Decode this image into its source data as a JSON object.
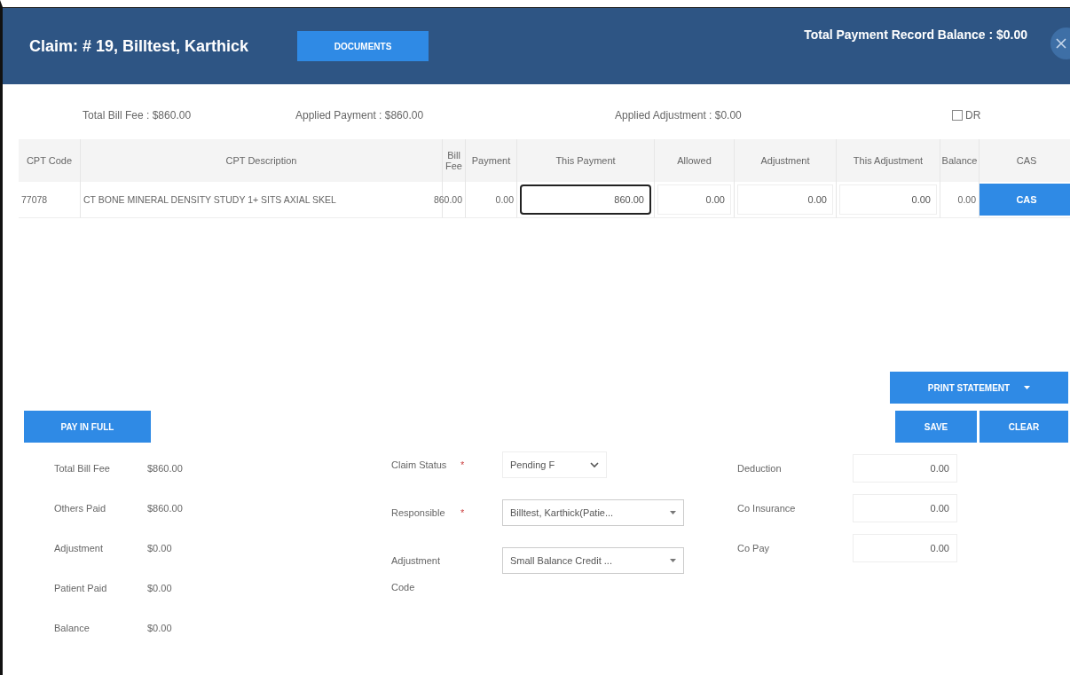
{
  "header": {
    "title": "Claim: # 19, Billtest, Karthick",
    "documents_button": "DOCUMENTS",
    "balance": "Total Payment Record Balance : $0.00"
  },
  "summary": {
    "total_bill_fee": "Total Bill Fee : $860.00",
    "applied_payment": "Applied Payment : $860.00",
    "applied_adjustment": "Applied Adjustment : $0.00",
    "dr": {
      "label": "DR",
      "checked": false
    }
  },
  "table": {
    "columns": [
      "CPT Code",
      "CPT Description",
      "Bill Fee",
      "Payment",
      "This Payment",
      "Allowed",
      "Adjustment",
      "This Adjustment",
      "Balance",
      "CAS"
    ],
    "rows": [
      {
        "cells": [
          {
            "kind": "text",
            "value": "77078"
          },
          {
            "kind": "text",
            "value": "CT BONE MINERAL DENSITY STUDY 1+ SITS AXIAL SKEL"
          },
          {
            "kind": "number",
            "value": "860.00"
          },
          {
            "kind": "number",
            "value": "0.00"
          },
          {
            "kind": "input",
            "value": "860.00",
            "focused": true
          },
          {
            "kind": "input",
            "value": "0.00",
            "focused": false
          },
          {
            "kind": "input",
            "value": "0.00",
            "focused": false
          },
          {
            "kind": "input",
            "value": "0.00",
            "focused": false
          },
          {
            "kind": "number",
            "value": "0.00"
          },
          {
            "kind": "button",
            "value": "CAS"
          }
        ]
      }
    ]
  },
  "actions": {
    "pay_in_full": "PAY IN FULL",
    "print_statement": "PRINT STATEMENT",
    "save": "SAVE",
    "clear": "CLEAR"
  },
  "totals": [
    {
      "label": "Total Bill Fee",
      "value": "$860.00"
    },
    {
      "label": "Others Paid",
      "value": "$860.00"
    },
    {
      "label": "Adjustment",
      "value": "$0.00"
    },
    {
      "label": "Patient Paid",
      "value": "$0.00"
    },
    {
      "label": "Balance",
      "value": "$0.00"
    }
  ],
  "claim_fields": [
    {
      "label": "Claim Status",
      "required_mark": "*",
      "value": "Pending F",
      "kind": "select"
    },
    {
      "label": "Responsible",
      "required_mark": "*",
      "value": "Billtest, Karthick(Patie...",
      "kind": "dropdown"
    },
    {
      "label": "Adjustment Code",
      "value": "Small Balance Credit ...",
      "kind": "dropdown"
    }
  ],
  "amount_fields": [
    {
      "label": "Deduction",
      "value": "0.00"
    },
    {
      "label": "Co Insurance",
      "value": "0.00"
    },
    {
      "label": "Co Pay",
      "value": "0.00"
    }
  ]
}
